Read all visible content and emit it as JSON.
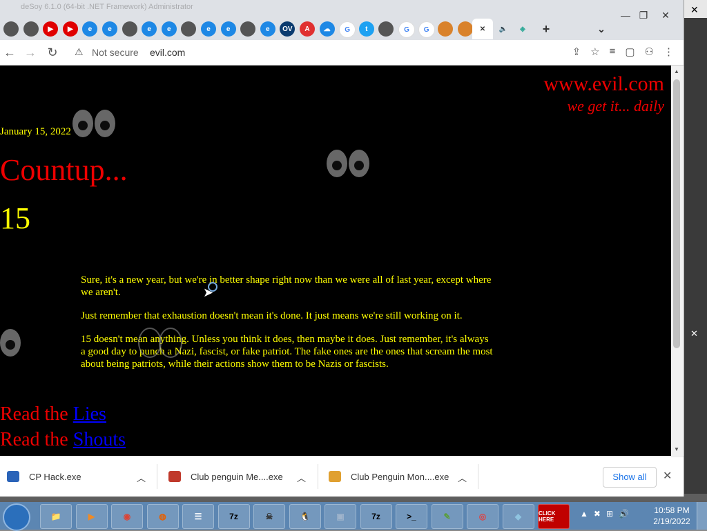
{
  "background_window": {
    "close_label": "✕"
  },
  "window": {
    "title": "deSoy 6.1.0 (64-bit .NET Framework) Administrator",
    "minimize": "—",
    "restore": "❐",
    "close": "✕"
  },
  "tabs": [
    {
      "icon": "globe-icon",
      "color": "#555555",
      "text": ""
    },
    {
      "icon": "globe-icon",
      "color": "#555555",
      "text": ""
    },
    {
      "icon": "youtube-icon",
      "color": "#e00000",
      "text": "▶"
    },
    {
      "icon": "youtube-icon",
      "color": "#e00000",
      "text": "▶"
    },
    {
      "icon": "edge-icon",
      "color": "#1e88e5",
      "text": "e"
    },
    {
      "icon": "edge-icon",
      "color": "#1e88e5",
      "text": "e"
    },
    {
      "icon": "globe-icon",
      "color": "#555555",
      "text": ""
    },
    {
      "icon": "edge-icon",
      "color": "#1e88e5",
      "text": "e"
    },
    {
      "icon": "edge-icon",
      "color": "#1e88e5",
      "text": "e"
    },
    {
      "icon": "globe-icon",
      "color": "#555555",
      "text": ""
    },
    {
      "icon": "edge-icon",
      "color": "#1e88e5",
      "text": "e"
    },
    {
      "icon": "edge-icon",
      "color": "#1e88e5",
      "text": "e"
    },
    {
      "icon": "globe-icon",
      "color": "#555555",
      "text": ""
    },
    {
      "icon": "edge-icon",
      "color": "#1e88e5",
      "text": "e"
    },
    {
      "icon": "ov-icon",
      "color": "#0b3b6f",
      "text": "OV"
    },
    {
      "icon": "adobe-icon",
      "color": "#e03030",
      "text": "A"
    },
    {
      "icon": "cloud-icon",
      "color": "#1e88e5",
      "text": "☁"
    },
    {
      "icon": "google-icon",
      "color": "#ffffff",
      "text": "G"
    },
    {
      "icon": "twitter-icon",
      "color": "#1da1f2",
      "text": "t"
    },
    {
      "icon": "globe-icon",
      "color": "#555555",
      "text": ""
    },
    {
      "icon": "google-icon",
      "color": "#ffffff",
      "text": "G"
    },
    {
      "icon": "google-icon",
      "color": "#ffffff",
      "text": "G"
    },
    {
      "icon": "profile-icon",
      "color": "#d9822b",
      "text": ""
    },
    {
      "icon": "profile-icon",
      "color": "#d9822b",
      "text": ""
    }
  ],
  "active_tab": {
    "close": "✕"
  },
  "extra_tabs": [
    {
      "icon": "sound-icon",
      "text": "🔈"
    },
    {
      "icon": "app-icon",
      "text": "◈"
    }
  ],
  "new_tab": "+",
  "tab_search": "⌄",
  "nav": {
    "back": "←",
    "forward": "→",
    "reload": "↻"
  },
  "omnibox": {
    "warning_icon": "⚠",
    "not_secure": "Not secure",
    "url": "evil.com"
  },
  "toolbar_right": [
    "⇪",
    "☆",
    "≡",
    "▢",
    "⚇",
    "⋮"
  ],
  "page": {
    "site_title": "www.evil.com",
    "tagline": "we get it... daily",
    "date": "January 15, 2022",
    "heading": "Countup...",
    "number": "15",
    "paragraphs": [
      "Sure, it's a new year, but we're in better shape right now than we were all of last year, except where we aren't.",
      "Just remember that exhaustion doesn't mean it's done. It just means we're still working on it.",
      "15 doesn't mean anything. Unless you think it does, then maybe it does. Just remember, it's always a good day to punch a Nazi, fascist, or fake patriot. The fake ones are the ones that scream the most about being patriots, while their actions show them to be Nazis or fascists."
    ],
    "read_prefix": "Read the",
    "link_lies": "Lies",
    "link_shouts": "Shouts"
  },
  "downloads": [
    {
      "name": "CP Hack.exe",
      "color": "#2a63b8"
    },
    {
      "name": "Club penguin Me....exe",
      "color": "#c0392b"
    },
    {
      "name": "Club Penguin Mon....exe",
      "color": "#e0a030"
    }
  ],
  "show_all": "Show all",
  "downloads_close": "✕",
  "taskbar": {
    "apps": [
      {
        "name": "explorer",
        "text": "📁",
        "color": "#e8c56a"
      },
      {
        "name": "media",
        "text": "▶",
        "color": "#f08a24"
      },
      {
        "name": "chrome",
        "text": "◉",
        "color": "#db4437"
      },
      {
        "name": "firefox",
        "text": "◍",
        "color": "#e66000"
      },
      {
        "name": "list",
        "text": "☰",
        "color": "#ffffff"
      },
      {
        "name": "7zip",
        "text": "7z",
        "color": "#000000"
      },
      {
        "name": "pirate",
        "text": "☠",
        "color": "#333333"
      },
      {
        "name": "penguin",
        "text": "🐧",
        "color": "#000000"
      },
      {
        "name": "windows",
        "text": "▣",
        "color": "#9fb4cc"
      },
      {
        "name": "7zip2",
        "text": "7z",
        "color": "#000000"
      },
      {
        "name": "cmd",
        "text": ">_",
        "color": "#000000"
      },
      {
        "name": "notepad",
        "text": "✎",
        "color": "#5a9e3a"
      },
      {
        "name": "lifebuoy",
        "text": "◎",
        "color": "#e04040"
      },
      {
        "name": "paint",
        "text": "◆",
        "color": "#8fc4e0"
      },
      {
        "name": "clickhere",
        "text": "CLICK HERE",
        "color": "#c00000"
      }
    ],
    "tray": [
      "▲",
      "✖",
      "⊞",
      "🔊"
    ],
    "time": "10:58 PM",
    "date": "2/19/2022"
  }
}
